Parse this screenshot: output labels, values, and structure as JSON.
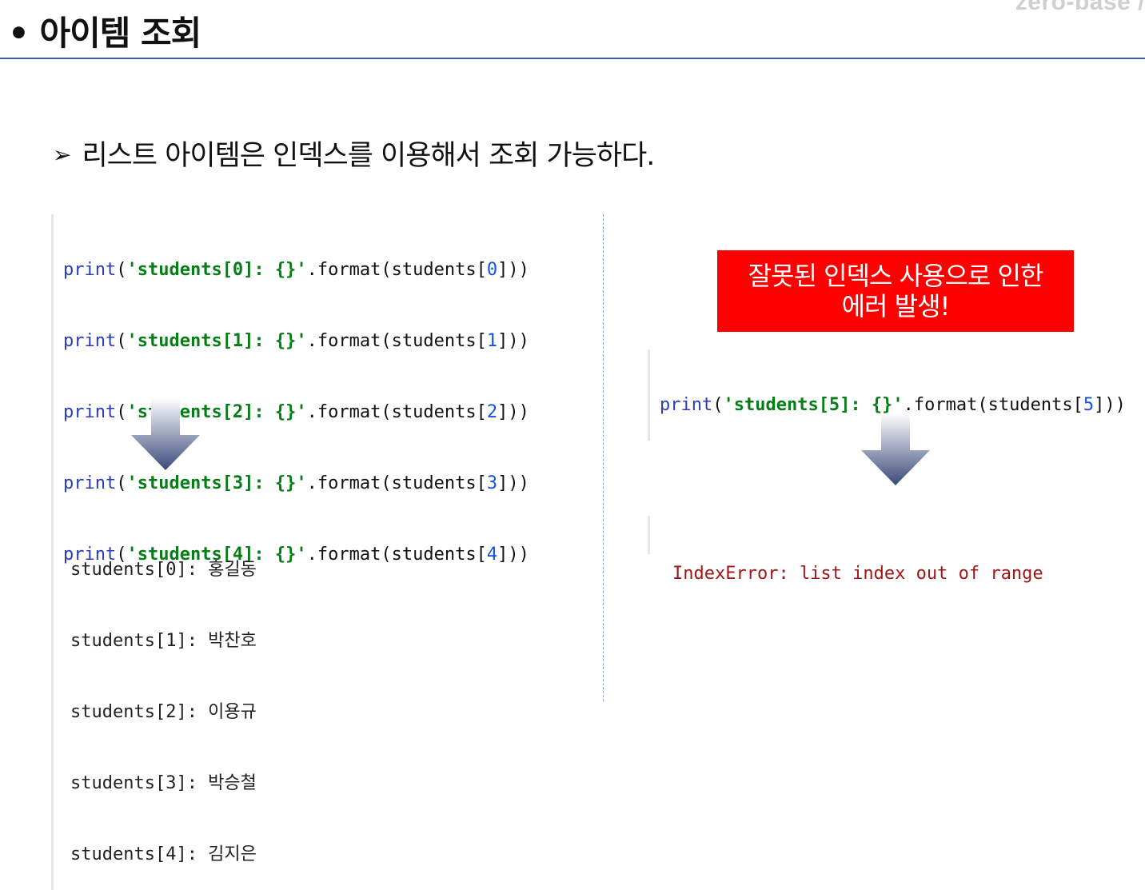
{
  "logo": "zero-base /",
  "title": "• 아이템 조회",
  "subtitle": {
    "bullet": "➢",
    "text": "리스트 아이템은 인덱스를 이용해서 조회 가능하다."
  },
  "left_code": [
    {
      "fn": "print",
      "open": "(",
      "str": "'students[0]: {}'",
      "mid": ".format(students[",
      "idx": "0",
      "close": "]))"
    },
    {
      "fn": "print",
      "open": "(",
      "str": "'students[1]: {}'",
      "mid": ".format(students[",
      "idx": "1",
      "close": "]))"
    },
    {
      "fn": "print",
      "open": "(",
      "str": "'students[2]: {}'",
      "mid": ".format(students[",
      "idx": "2",
      "close": "]))"
    },
    {
      "fn": "print",
      "open": "(",
      "str": "'students[3]: {}'",
      "mid": ".format(students[",
      "idx": "3",
      "close": "]))"
    },
    {
      "fn": "print",
      "open": "(",
      "str": "'students[4]: {}'",
      "mid": ".format(students[",
      "idx": "4",
      "close": "]))"
    }
  ],
  "left_output": [
    "students[0]: 홍길동",
    "students[1]: 박찬호",
    "students[2]: 이용규",
    "students[3]: 박승철",
    "students[4]: 김지은"
  ],
  "callout": {
    "line1": "잘못된 인덱스 사용으로 인한",
    "line2": "에러 발생!"
  },
  "right_code": {
    "fn": "print",
    "open": "(",
    "str": "'students[5]: {}'",
    "mid": ".format(students[",
    "idx": "5",
    "close": "]))"
  },
  "right_output": "IndexError: list index out of range",
  "colors": {
    "keyword": "#2b3bbf",
    "string": "#067d17",
    "number": "#1750eb",
    "error": "#a31515",
    "callout_bg": "#ff0000",
    "rule": "#3f5fa3"
  },
  "icons": [
    "down-arrow-icon",
    "down-arrow-icon"
  ]
}
